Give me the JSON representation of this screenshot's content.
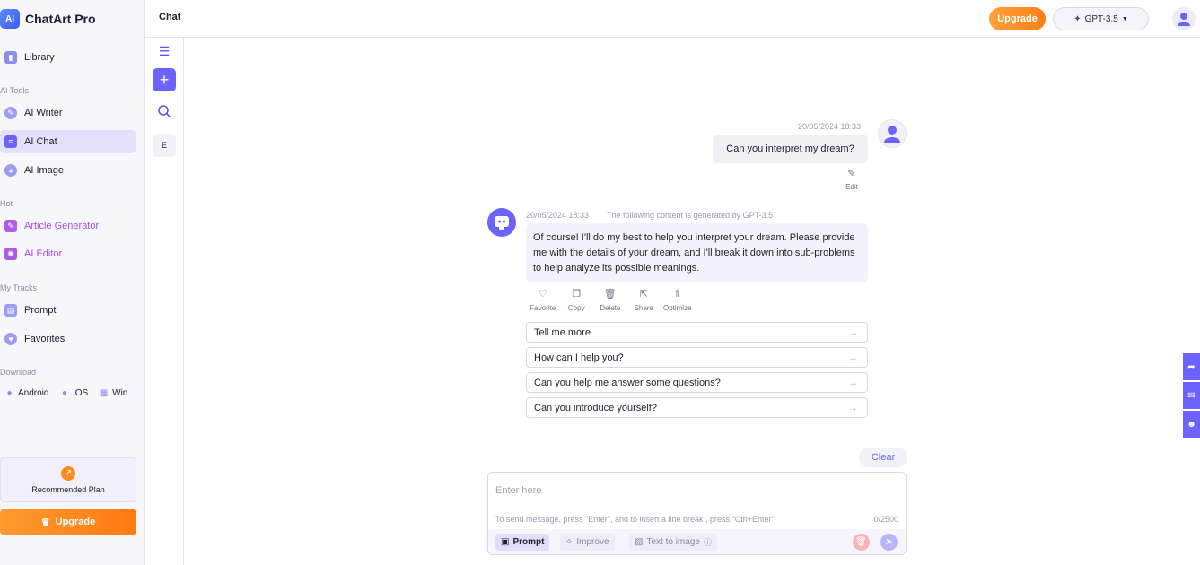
{
  "app": {
    "name": "ChatArt Pro",
    "logo_letters": "AI"
  },
  "sidebar": {
    "library": "Library",
    "sections": {
      "ai_tools": "AI Tools",
      "hot": "Hot",
      "my_tracks": "My Tracks",
      "download": "Download"
    },
    "items": {
      "ai_writer": "AI Writer",
      "ai_chat": "AI Chat",
      "ai_image": "AI Image",
      "article_generator": "Article Generator",
      "ai_editor": "AI Editor",
      "prompt": "Prompt",
      "favorites": "Favorites"
    },
    "downloads": {
      "android": "Android",
      "ios": "iOS",
      "win": "Win"
    },
    "recommended_plan": "Recommended Plan",
    "upgrade": "Upgrade"
  },
  "toolcol": {
    "letter": "E"
  },
  "header": {
    "title": "Chat",
    "upgrade": "Upgrade",
    "model": "GPT-3.5"
  },
  "chat": {
    "user_msg": {
      "time": "20/05/2024 18:33",
      "text": "Can you interpret my dream?",
      "edit": "Edit"
    },
    "bot_msg": {
      "time": "20/05/2024 18:33",
      "note": "The following content is generated by GPT-3.5",
      "text": "Of course! I'll do my best to help you interpret your dream. Please provide me with the details of your dream, and I'll break it down into sub-problems to help analyze its possible meanings."
    },
    "actions": {
      "favorite": "Favorite",
      "copy": "Copy",
      "delete": "Delete",
      "share": "Share",
      "optimize": "Optimize"
    },
    "suggestions": [
      "Tell me more",
      "How can I help you?",
      "Can you help me answer some questions?",
      "Can you introduce yourself?"
    ],
    "clear": "Clear"
  },
  "composer": {
    "placeholder": "Enter here",
    "hint": "To send message, press \"Enter\", and to insert a line break , press \"Ctrl+Enter\"",
    "count": "0/2500",
    "prompt": "Prompt",
    "improve": "Improve",
    "text_to_image": "Text to image"
  },
  "colors": {
    "accent": "#6c63ff",
    "upgrade": "#ff8a1e",
    "hot_text": "#a14ee6"
  }
}
